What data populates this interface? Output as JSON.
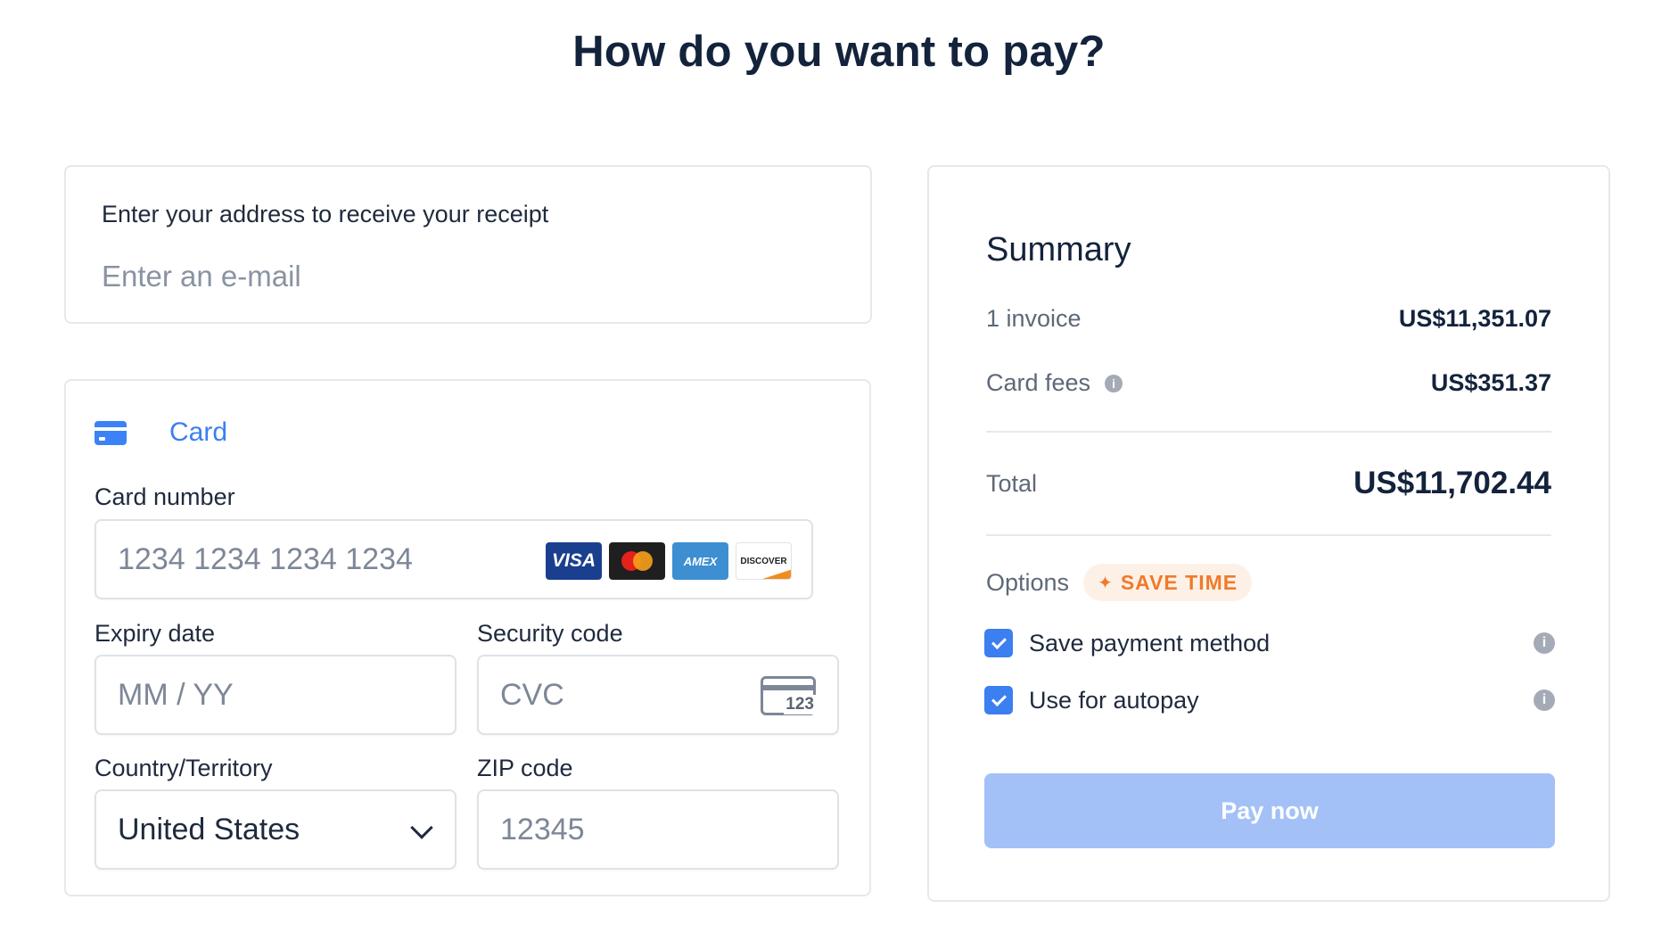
{
  "page": {
    "title": "How do you want to pay?"
  },
  "email": {
    "label": "Enter your address to receive your receipt",
    "placeholder": "Enter an e-mail",
    "value": ""
  },
  "payment": {
    "method": {
      "label": "Card",
      "icon": "credit-card-icon"
    },
    "card_number": {
      "label": "Card number",
      "placeholder": "1234 1234 1234 1234"
    },
    "brands": [
      {
        "name": "visa",
        "label": "VISA"
      },
      {
        "name": "mastercard"
      },
      {
        "name": "amex",
        "label": "AMEX"
      },
      {
        "name": "discover",
        "label": "DISCOVER"
      }
    ],
    "expiry": {
      "label": "Expiry date",
      "placeholder": "MM / YY"
    },
    "security": {
      "label": "Security code",
      "placeholder": "CVC",
      "icon_text": "123"
    },
    "country": {
      "label": "Country/Territory",
      "value": "United States"
    },
    "zip": {
      "label": "ZIP code",
      "placeholder": "12345"
    }
  },
  "summary": {
    "title": "Summary",
    "invoice_label": "1 invoice",
    "invoice_value": "US$11,351.07",
    "fees_label": "Card fees",
    "fees_value": "US$351.37",
    "total_label": "Total",
    "total_value": "US$11,702.44",
    "options_label": "Options",
    "badge_label": "SAVE TIME",
    "save_method_label": "Save payment method",
    "autopay_label": "Use for autopay",
    "pay_button": "Pay now"
  },
  "colors": {
    "accent": "#3b7ff0",
    "pay_button_disabled": "#a3c1f7",
    "badge_text": "#f07a2c",
    "badge_bg": "#fdf1e7"
  }
}
